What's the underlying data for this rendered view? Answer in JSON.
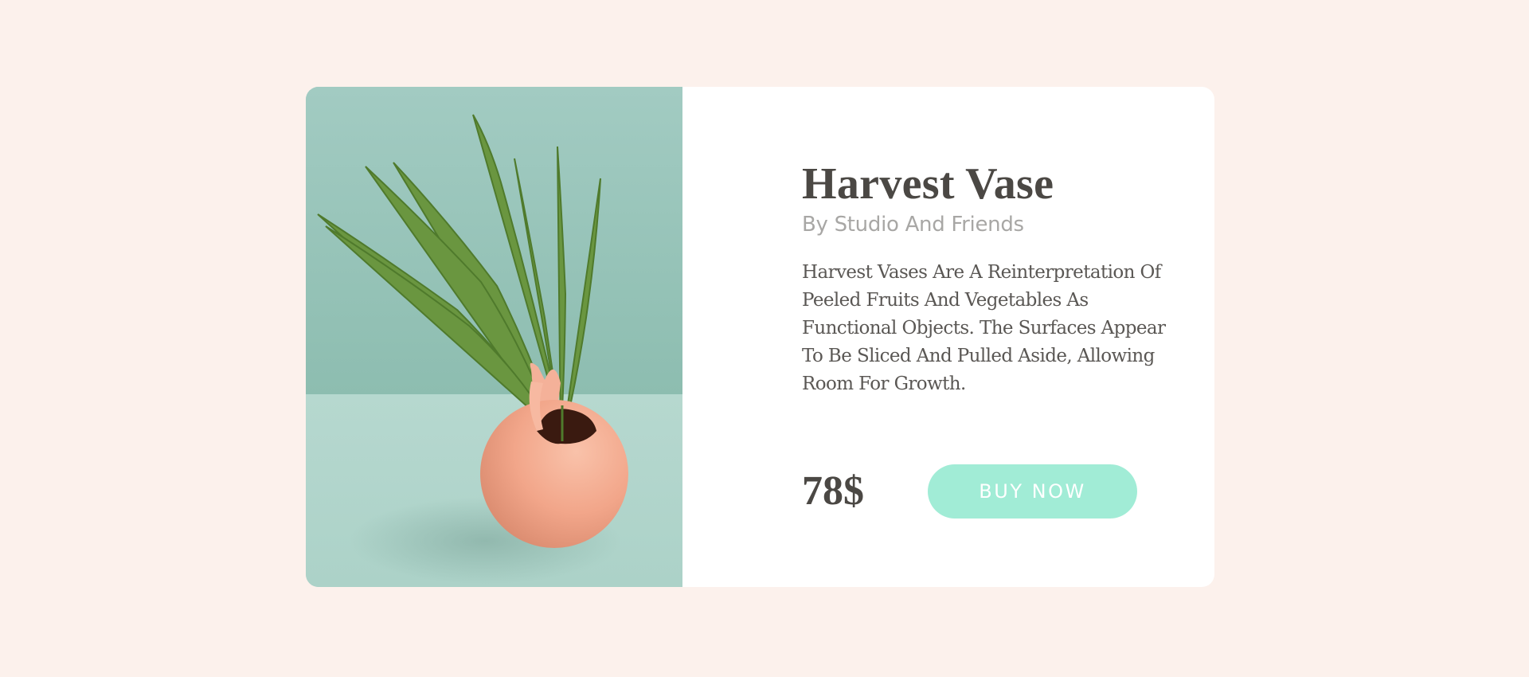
{
  "product": {
    "title": "Harvest Vase",
    "subtitle": "By Studio And Friends",
    "description": "Harvest Vases Are A Reinterpretation Of Peeled Fruits And Vegetables As Functional Objects. The Surfaces Appear To Be Sliced And Pulled Aside, Allowing Room For Growth.",
    "price": "78$",
    "buy_label": "BUY NOW",
    "image_icon": "vase-with-palm-leaves-photo"
  },
  "colors": {
    "page_background": "#fcf1ec",
    "card_background": "#ffffff",
    "button_background": "#a1ecd6",
    "title_color": "#4b4844",
    "subtitle_color": "#a8a7a5",
    "image_wall": "#a3cbc2",
    "image_table": "#b4d6cd",
    "vase_color": "#f2a68a",
    "leaf_color": "#5e8a3a"
  }
}
